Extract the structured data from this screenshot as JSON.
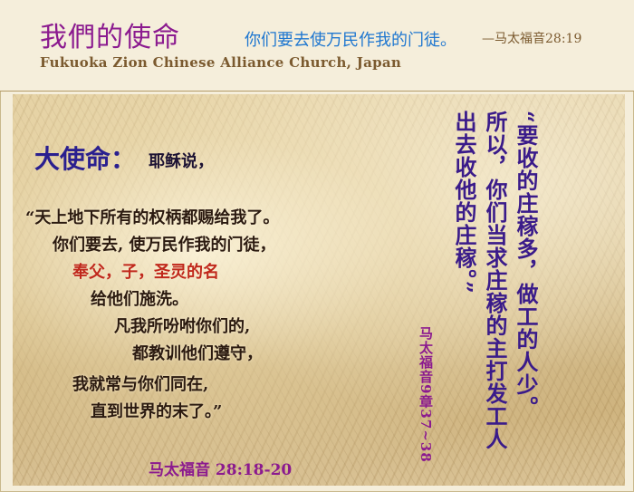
{
  "header": {
    "title": "我們的使命",
    "verse": "你们要去使万民作我的门徒。",
    "verse_ref": "—马太福音28:19",
    "church_name": "Fukuoka Zion Chinese Alliance Church, Japan"
  },
  "mission": {
    "label": "大使命：",
    "intro": "耶稣说，",
    "lines": [
      "“天上地下所有的权柄都赐给我了。",
      "你们要去, 使万民作我的门徒，",
      "奉父，子，圣灵的名",
      "给他们施洗。",
      "凡我所吩咐你们的,",
      "都教训他们遵守，",
      "我就常与你们同在,",
      "直到世界的末了。”"
    ],
    "reference": "马太福音 28:18-20"
  },
  "harvest": {
    "columns": [
      "“要收的庄稼多，做工的人少。",
      "所以，你们当求庄稼的主打发工人",
      "出去收他的庄稼。”"
    ],
    "reference": "马太福音9章37~38"
  },
  "colors": {
    "title": "#8b1a8f",
    "verse": "#1f77d0",
    "mission_label": "#2a1f8f",
    "highlight": "#c0281c",
    "harvest_text": "#3a1b8a"
  }
}
